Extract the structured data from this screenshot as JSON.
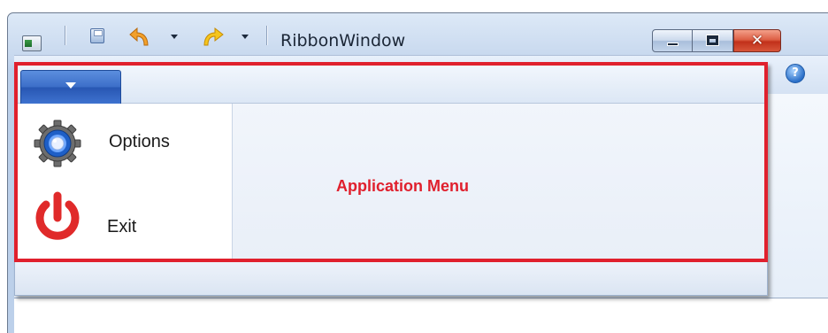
{
  "window": {
    "title": "RibbonWindow",
    "close_glyph": "✕"
  },
  "quick_access_toolbar": {
    "icons": [
      "app-icon",
      "save-icon",
      "undo-icon",
      "redo-icon"
    ]
  },
  "ribbon": {
    "help_glyph": "?"
  },
  "application_menu": {
    "items": [
      {
        "label": "Options",
        "icon": "gear-icon"
      },
      {
        "label": "Exit",
        "icon": "power-icon"
      }
    ],
    "annotation": "Application Menu"
  },
  "colors": {
    "annotation": "#e0202d",
    "app_button": "#2857b3",
    "exit_icon": "#e02a2a"
  }
}
